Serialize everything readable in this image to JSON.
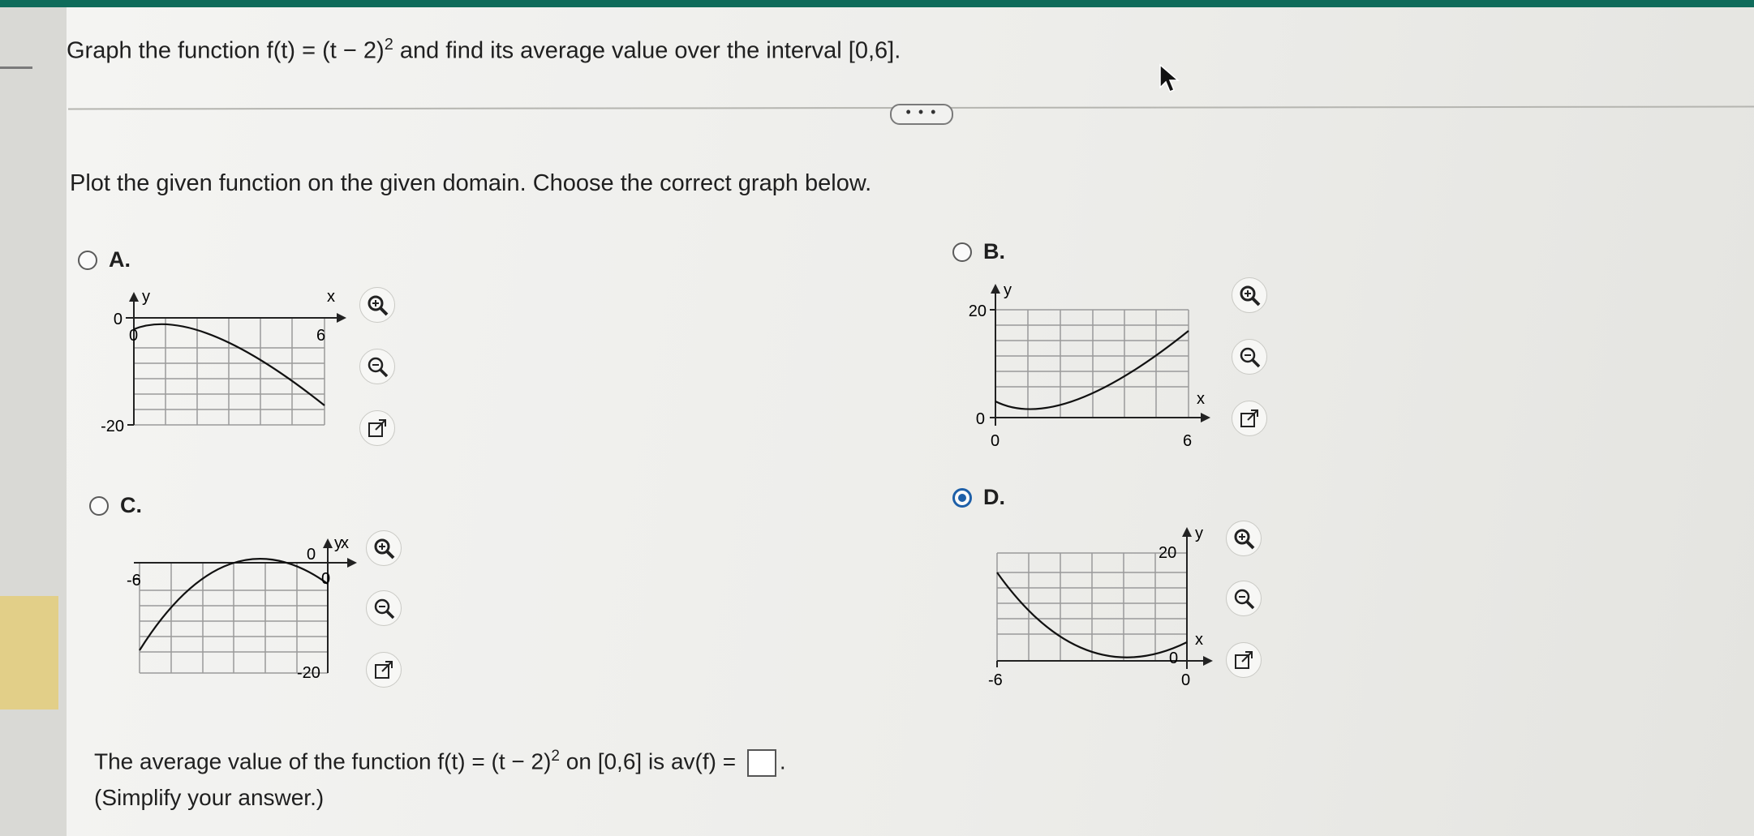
{
  "question": {
    "prefix": "Graph the function f(t) = (t − 2)",
    "exponent": "2",
    "suffix": " and find its average value over the interval [0,6]."
  },
  "more_label": "• • •",
  "prompt": "Plot the given function on the given domain. Choose the correct graph below.",
  "options": [
    {
      "letter": "A.",
      "selected": false
    },
    {
      "letter": "B.",
      "selected": false
    },
    {
      "letter": "C.",
      "selected": false
    },
    {
      "letter": "D.",
      "selected": true
    }
  ],
  "graphs": {
    "a": {
      "ymax_label": "0",
      "ymin_label": "-20",
      "y_label": "y",
      "x_label": "x",
      "x0_label": "0",
      "x6_label": "6"
    },
    "b": {
      "ymax_label": "20",
      "ymin_label": "0",
      "y_label": "y",
      "x_label": "x",
      "x0_label": "0",
      "x6_label": "6"
    },
    "c": {
      "y0_label": "0",
      "x0_label": "0",
      "ymin_label": "-20",
      "xmin_label": "-6",
      "y_label": "y",
      "x_label": "x"
    },
    "d": {
      "ymax_label": "20",
      "y_label": "y",
      "x_label": "x",
      "y0_label": "0",
      "xmin_label": "-6",
      "x0_label": "0"
    }
  },
  "answer": {
    "prefix": "The average value of the function f(t) = (t − 2)",
    "exponent": "2",
    "suffix": " on [0,6] is av(f) = ",
    "end": ".",
    "note": "(Simplify your answer.)"
  },
  "icons": [
    "zoom-in-icon",
    "zoom-out-icon",
    "external-link-icon"
  ],
  "colors": {
    "topbar": "#0f6b5a",
    "selected_radio": "#1d5fa8",
    "left_accent": "#e2cf88"
  }
}
